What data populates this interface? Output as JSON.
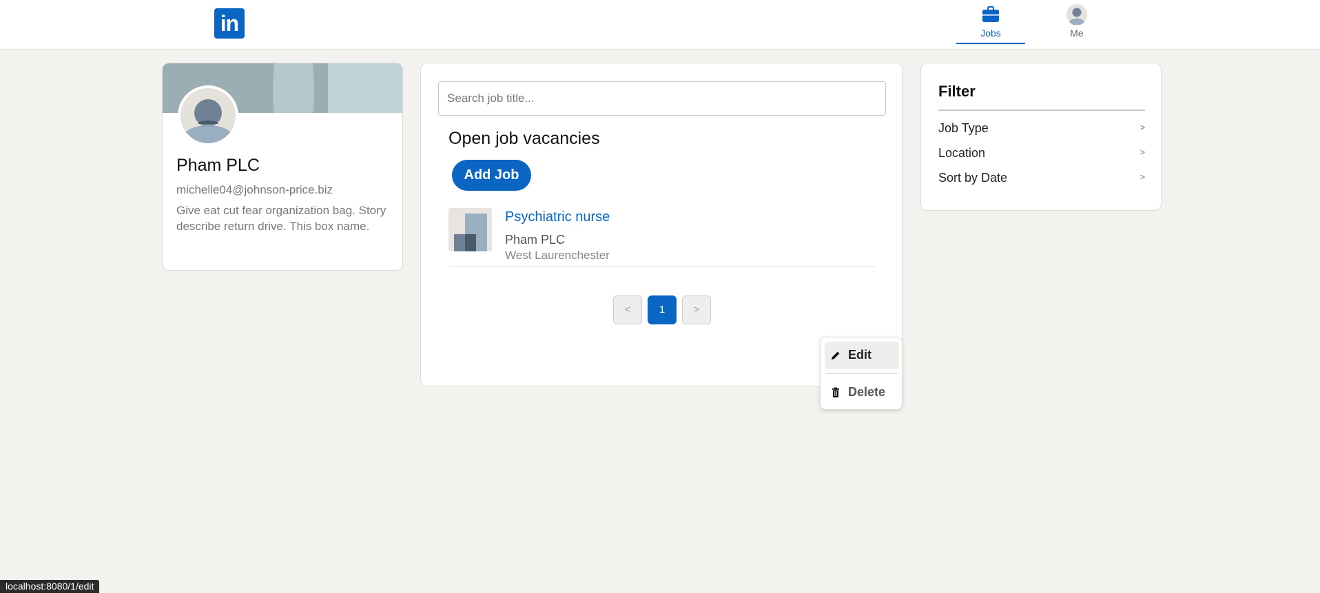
{
  "header": {
    "logo_text": "in",
    "nav": [
      {
        "label": "Jobs",
        "icon": "briefcase-icon",
        "active": true
      },
      {
        "label": "Me",
        "icon": "avatar-icon",
        "active": false
      }
    ]
  },
  "profile": {
    "name": "Pham PLC",
    "email": "michelle04@johnson-price.biz",
    "description": "Give eat cut fear organization bag. Story describe return drive. This box name."
  },
  "main": {
    "search_placeholder": "Search job title...",
    "section_title": "Open job vacancies",
    "add_job_label": "Add Job",
    "jobs": [
      {
        "title": "Psychiatric nurse",
        "company": "Pham PLC",
        "location": "West Laurenchester"
      }
    ],
    "menu": {
      "edit_label": "Edit",
      "delete_label": "Delete"
    },
    "pagination": {
      "prev": "<",
      "current": "1",
      "next": ">"
    }
  },
  "filter": {
    "title": "Filter",
    "items": [
      {
        "label": "Job Type",
        "chevron": ">"
      },
      {
        "label": "Location",
        "chevron": ">"
      },
      {
        "label": "Sort by Date",
        "chevron": ">"
      }
    ]
  },
  "status_bar": {
    "url": "localhost:8080/1/edit"
  },
  "colors": {
    "accent": "#0a66c2",
    "background": "#f3f2ef"
  }
}
